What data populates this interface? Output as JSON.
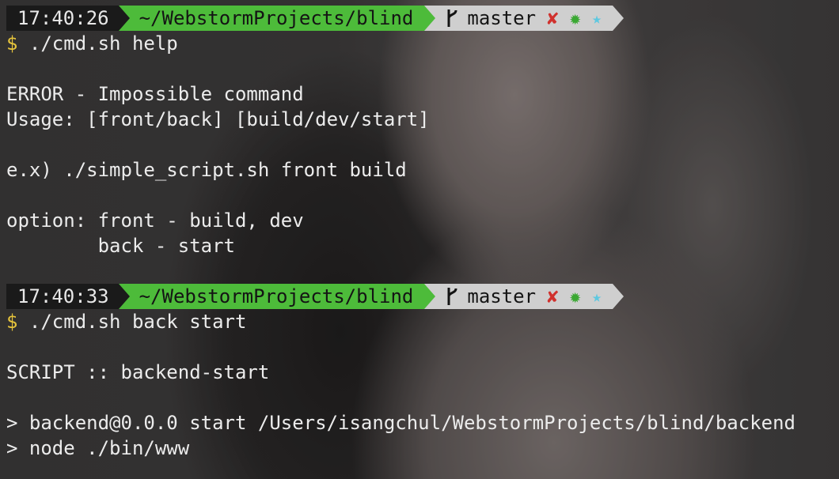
{
  "prompts": [
    {
      "time": "17:40:26",
      "path": "~/WebstormProjects/blind",
      "branch": "master",
      "dirty_symbol": "✘",
      "staged_symbol": "✹",
      "untracked_symbol": "★",
      "dollar": "$",
      "command": " ./cmd.sh help"
    },
    {
      "time": "17:40:33",
      "path": "~/WebstormProjects/blind",
      "branch": "master",
      "dirty_symbol": "✘",
      "staged_symbol": "✹",
      "untracked_symbol": "★",
      "dollar": "$",
      "command": " ./cmd.sh back start"
    }
  ],
  "output1": [
    "ERROR - Impossible command",
    "Usage: [front/back] [build/dev/start]",
    "e.x) ./simple_script.sh front build",
    "option: front - build, dev",
    "        back - start"
  ],
  "output2": [
    "SCRIPT :: backend-start",
    "> backend@0.0.0 start /Users/isangchul/WebstormProjects/blind/backend",
    "> node ./bin/www"
  ],
  "colors": {
    "time_bg": "#1a1a1a",
    "path_bg": "#4dbb3a",
    "git_bg": "#cfcfcf",
    "dollar": "#e7c53c",
    "dirty": "#d0312d",
    "staged": "#3aa832",
    "untracked": "#5ec8e0"
  },
  "icons": {
    "branch": "git-branch-icon"
  }
}
